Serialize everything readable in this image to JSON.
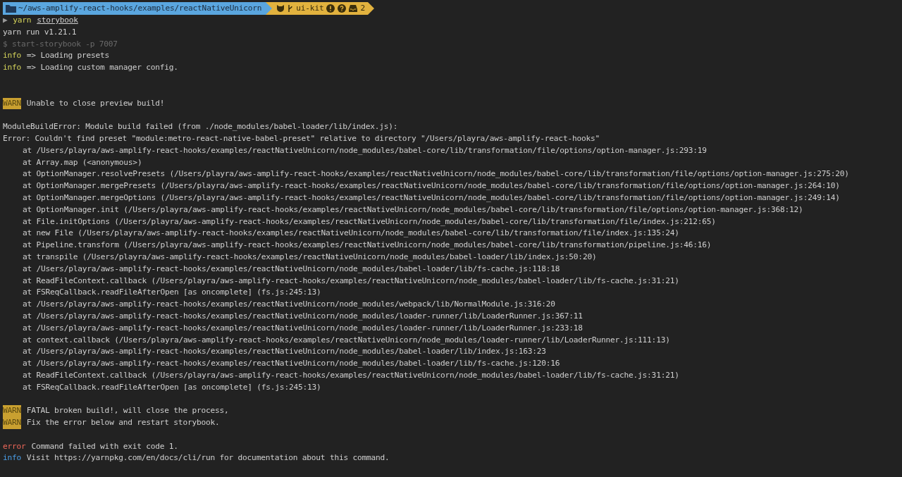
{
  "prompt": {
    "path": "~/aws-amplify-react-hooks/examples/reactNativeUnicorn",
    "branch": "ui-kit",
    "stash_count": "2"
  },
  "command": {
    "symbol": "▶",
    "program": "yarn",
    "argument": "storybook"
  },
  "lines": [
    {
      "kind": "plain",
      "text": "yarn run v1.21.1"
    },
    {
      "kind": "dim",
      "text": "$ start-storybook -p 7007"
    },
    {
      "kind": "info",
      "tag": "info",
      "text": "=> Loading presets"
    },
    {
      "kind": "info",
      "tag": "info",
      "text": "=> Loading custom manager config."
    },
    {
      "kind": "blank"
    },
    {
      "kind": "blank"
    },
    {
      "kind": "warn",
      "tag": "WARN",
      "text": "Unable to close preview build!"
    },
    {
      "kind": "blank"
    },
    {
      "kind": "plain",
      "text": "ModuleBuildError: Module build failed (from ./node_modules/babel-loader/lib/index.js):"
    },
    {
      "kind": "plain",
      "text": "Error: Couldn't find preset \"module:metro-react-native-babel-preset\" relative to directory \"/Users/playra/aws-amplify-react-hooks\""
    },
    {
      "kind": "stack",
      "text": "at /Users/playra/aws-amplify-react-hooks/examples/reactNativeUnicorn/node_modules/babel-core/lib/transformation/file/options/option-manager.js:293:19"
    },
    {
      "kind": "stack",
      "text": "at Array.map (<anonymous>)"
    },
    {
      "kind": "stack",
      "text": "at OptionManager.resolvePresets (/Users/playra/aws-amplify-react-hooks/examples/reactNativeUnicorn/node_modules/babel-core/lib/transformation/file/options/option-manager.js:275:20)"
    },
    {
      "kind": "stack",
      "text": "at OptionManager.mergePresets (/Users/playra/aws-amplify-react-hooks/examples/reactNativeUnicorn/node_modules/babel-core/lib/transformation/file/options/option-manager.js:264:10)"
    },
    {
      "kind": "stack",
      "text": "at OptionManager.mergeOptions (/Users/playra/aws-amplify-react-hooks/examples/reactNativeUnicorn/node_modules/babel-core/lib/transformation/file/options/option-manager.js:249:14)"
    },
    {
      "kind": "stack",
      "text": "at OptionManager.init (/Users/playra/aws-amplify-react-hooks/examples/reactNativeUnicorn/node_modules/babel-core/lib/transformation/file/options/option-manager.js:368:12)"
    },
    {
      "kind": "stack",
      "text": "at File.initOptions (/Users/playra/aws-amplify-react-hooks/examples/reactNativeUnicorn/node_modules/babel-core/lib/transformation/file/index.js:212:65)"
    },
    {
      "kind": "stack",
      "text": "at new File (/Users/playra/aws-amplify-react-hooks/examples/reactNativeUnicorn/node_modules/babel-core/lib/transformation/file/index.js:135:24)"
    },
    {
      "kind": "stack",
      "text": "at Pipeline.transform (/Users/playra/aws-amplify-react-hooks/examples/reactNativeUnicorn/node_modules/babel-core/lib/transformation/pipeline.js:46:16)"
    },
    {
      "kind": "stack",
      "text": "at transpile (/Users/playra/aws-amplify-react-hooks/examples/reactNativeUnicorn/node_modules/babel-loader/lib/index.js:50:20)"
    },
    {
      "kind": "stack",
      "text": "at /Users/playra/aws-amplify-react-hooks/examples/reactNativeUnicorn/node_modules/babel-loader/lib/fs-cache.js:118:18"
    },
    {
      "kind": "stack",
      "text": "at ReadFileContext.callback (/Users/playra/aws-amplify-react-hooks/examples/reactNativeUnicorn/node_modules/babel-loader/lib/fs-cache.js:31:21)"
    },
    {
      "kind": "stack",
      "text": "at FSReqCallback.readFileAfterOpen [as oncomplete] (fs.js:245:13)"
    },
    {
      "kind": "stack",
      "text": "at /Users/playra/aws-amplify-react-hooks/examples/reactNativeUnicorn/node_modules/webpack/lib/NormalModule.js:316:20"
    },
    {
      "kind": "stack",
      "text": "at /Users/playra/aws-amplify-react-hooks/examples/reactNativeUnicorn/node_modules/loader-runner/lib/LoaderRunner.js:367:11"
    },
    {
      "kind": "stack",
      "text": "at /Users/playra/aws-amplify-react-hooks/examples/reactNativeUnicorn/node_modules/loader-runner/lib/LoaderRunner.js:233:18"
    },
    {
      "kind": "stack",
      "text": "at context.callback (/Users/playra/aws-amplify-react-hooks/examples/reactNativeUnicorn/node_modules/loader-runner/lib/LoaderRunner.js:111:13)"
    },
    {
      "kind": "stack",
      "text": "at /Users/playra/aws-amplify-react-hooks/examples/reactNativeUnicorn/node_modules/babel-loader/lib/index.js:163:23"
    },
    {
      "kind": "stack",
      "text": "at /Users/playra/aws-amplify-react-hooks/examples/reactNativeUnicorn/node_modules/babel-loader/lib/fs-cache.js:120:16"
    },
    {
      "kind": "stack",
      "text": "at ReadFileContext.callback (/Users/playra/aws-amplify-react-hooks/examples/reactNativeUnicorn/node_modules/babel-loader/lib/fs-cache.js:31:21)"
    },
    {
      "kind": "stack",
      "text": "at FSReqCallback.readFileAfterOpen [as oncomplete] (fs.js:245:13)"
    },
    {
      "kind": "blank"
    },
    {
      "kind": "warn",
      "tag": "WARN",
      "text": "FATAL broken build!, will close the process,"
    },
    {
      "kind": "warn",
      "tag": "WARN",
      "text": "Fix the error below and restart storybook."
    },
    {
      "kind": "blank"
    },
    {
      "kind": "error",
      "tag": "error",
      "text": "Command failed with exit code 1."
    },
    {
      "kind": "note",
      "tag": "info",
      "text": "Visit https://yarnpkg.com/en/docs/cli/run for documentation about this command."
    }
  ]
}
